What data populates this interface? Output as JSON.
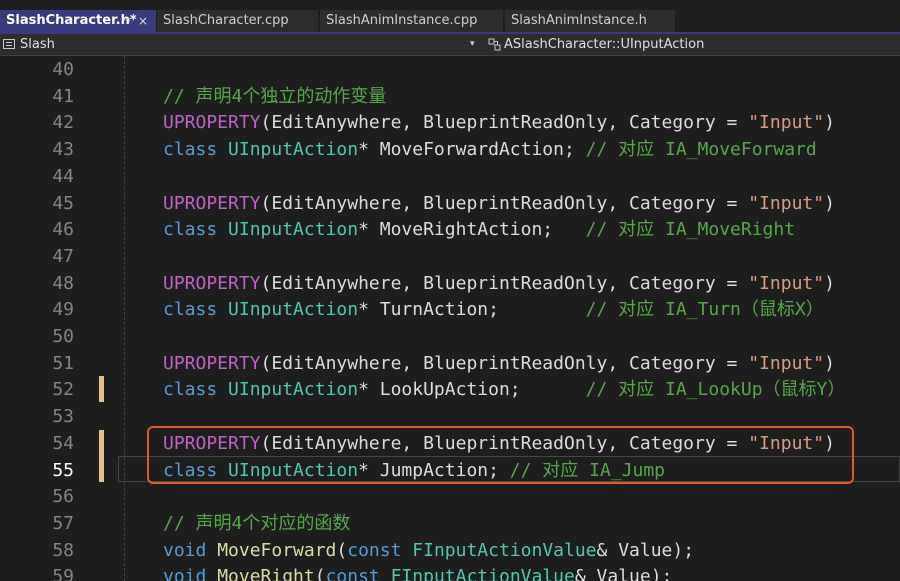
{
  "tabs": [
    {
      "label": "SlashCharacter.h*",
      "pin": "⇥",
      "close": "×"
    },
    {
      "label": "SlashCharacter.cpp"
    },
    {
      "label": "SlashAnimInstance.cpp"
    },
    {
      "label": "SlashAnimInstance.h"
    }
  ],
  "navbar": {
    "project": "Slash",
    "dropdown_arrow": "▾",
    "member": "ASlashCharacter::UInputAction"
  },
  "editor": {
    "current_line": 55,
    "line_numbers": [
      "40",
      "41",
      "42",
      "43",
      "44",
      "45",
      "46",
      "47",
      "48",
      "49",
      "50",
      "51",
      "52",
      "53",
      "54",
      "55",
      "56",
      "57",
      "58",
      "59"
    ],
    "lines": [
      {
        "n": 40,
        "tokens": []
      },
      {
        "n": 41,
        "tokens": [
          {
            "t": "// 声明4个独立的动作变量",
            "c": "cm"
          }
        ]
      },
      {
        "n": 42,
        "tokens": [
          {
            "t": "UPROPERTY",
            "c": "mc"
          },
          {
            "t": "(EditAnywhere, BlueprintReadOnly, Category = ",
            "c": "tx"
          },
          {
            "t": "\"Input\"",
            "c": "st"
          },
          {
            "t": ")",
            "c": "tx"
          }
        ]
      },
      {
        "n": 43,
        "tokens": [
          {
            "t": "class ",
            "c": "kw"
          },
          {
            "t": "UInputAction",
            "c": "ty"
          },
          {
            "t": "* MoveForwardAction; ",
            "c": "tx"
          },
          {
            "t": "// 对应 IA_MoveForward",
            "c": "cm"
          }
        ]
      },
      {
        "n": 44,
        "tokens": []
      },
      {
        "n": 45,
        "tokens": [
          {
            "t": "UPROPERTY",
            "c": "mc"
          },
          {
            "t": "(EditAnywhere, BlueprintReadOnly, Category = ",
            "c": "tx"
          },
          {
            "t": "\"Input\"",
            "c": "st"
          },
          {
            "t": ")",
            "c": "tx"
          }
        ]
      },
      {
        "n": 46,
        "tokens": [
          {
            "t": "class ",
            "c": "kw"
          },
          {
            "t": "UInputAction",
            "c": "ty"
          },
          {
            "t": "* MoveRightAction;   ",
            "c": "tx"
          },
          {
            "t": "// 对应 IA_MoveRight",
            "c": "cm"
          }
        ]
      },
      {
        "n": 47,
        "tokens": []
      },
      {
        "n": 48,
        "tokens": [
          {
            "t": "UPROPERTY",
            "c": "mc"
          },
          {
            "t": "(EditAnywhere, BlueprintReadOnly, Category = ",
            "c": "tx"
          },
          {
            "t": "\"Input\"",
            "c": "st"
          },
          {
            "t": ")",
            "c": "tx"
          }
        ]
      },
      {
        "n": 49,
        "tokens": [
          {
            "t": "class ",
            "c": "kw"
          },
          {
            "t": "UInputAction",
            "c": "ty"
          },
          {
            "t": "* TurnAction;        ",
            "c": "tx"
          },
          {
            "t": "// 对应 IA_Turn（鼠标X）",
            "c": "cm"
          }
        ]
      },
      {
        "n": 50,
        "tokens": []
      },
      {
        "n": 51,
        "tokens": [
          {
            "t": "UPROPERTY",
            "c": "mc"
          },
          {
            "t": "(EditAnywhere, BlueprintReadOnly, Category = ",
            "c": "tx"
          },
          {
            "t": "\"Input\"",
            "c": "st"
          },
          {
            "t": ")",
            "c": "tx"
          }
        ]
      },
      {
        "n": 52,
        "tokens": [
          {
            "t": "class ",
            "c": "kw"
          },
          {
            "t": "UInputAction",
            "c": "ty"
          },
          {
            "t": "* LookUpAction;      ",
            "c": "tx"
          },
          {
            "t": "// 对应 IA_LookUp（鼠标Y）",
            "c": "cm"
          }
        ]
      },
      {
        "n": 53,
        "tokens": []
      },
      {
        "n": 54,
        "tokens": [
          {
            "t": "UPROPERTY",
            "c": "mc"
          },
          {
            "t": "(EditAnywhere, BlueprintReadOnly, Category = ",
            "c": "tx"
          },
          {
            "t": "\"Input\"",
            "c": "st"
          },
          {
            "t": ")",
            "c": "tx"
          }
        ]
      },
      {
        "n": 55,
        "tokens": [
          {
            "t": "class ",
            "c": "kw"
          },
          {
            "t": "UInputAction",
            "c": "ty"
          },
          {
            "t": "* JumpAction; ",
            "c": "tx"
          },
          {
            "t": "// 对应 IA_Jump",
            "c": "cm"
          }
        ]
      },
      {
        "n": 56,
        "tokens": []
      },
      {
        "n": 57,
        "tokens": [
          {
            "t": "// 声明4个对应的函数",
            "c": "cm"
          }
        ]
      },
      {
        "n": 58,
        "tokens": [
          {
            "t": "void ",
            "c": "kw"
          },
          {
            "t": "MoveForward",
            "c": "fn"
          },
          {
            "t": "(",
            "c": "tx"
          },
          {
            "t": "const ",
            "c": "kw"
          },
          {
            "t": "FInputActionValue",
            "c": "ty"
          },
          {
            "t": "& Value);",
            "c": "tx"
          }
        ]
      },
      {
        "n": 59,
        "tokens": [
          {
            "t": "void ",
            "c": "kw"
          },
          {
            "t": "MoveRight",
            "c": "fn"
          },
          {
            "t": "(",
            "c": "tx"
          },
          {
            "t": "const ",
            "c": "kw"
          },
          {
            "t": "FInputActionValue",
            "c": "ty"
          },
          {
            "t": "& Value);",
            "c": "tx"
          }
        ]
      }
    ]
  },
  "colors": {
    "keyword": "#569cd6",
    "type": "#4ec9b0",
    "comment": "#57a64a",
    "string": "#d69d85",
    "macro": "#bd63c5",
    "function": "#dcdcaa",
    "highlight_box": "#e05a2a",
    "change_marker": "#e2c08d",
    "active_tab": "#3a3a7e"
  }
}
